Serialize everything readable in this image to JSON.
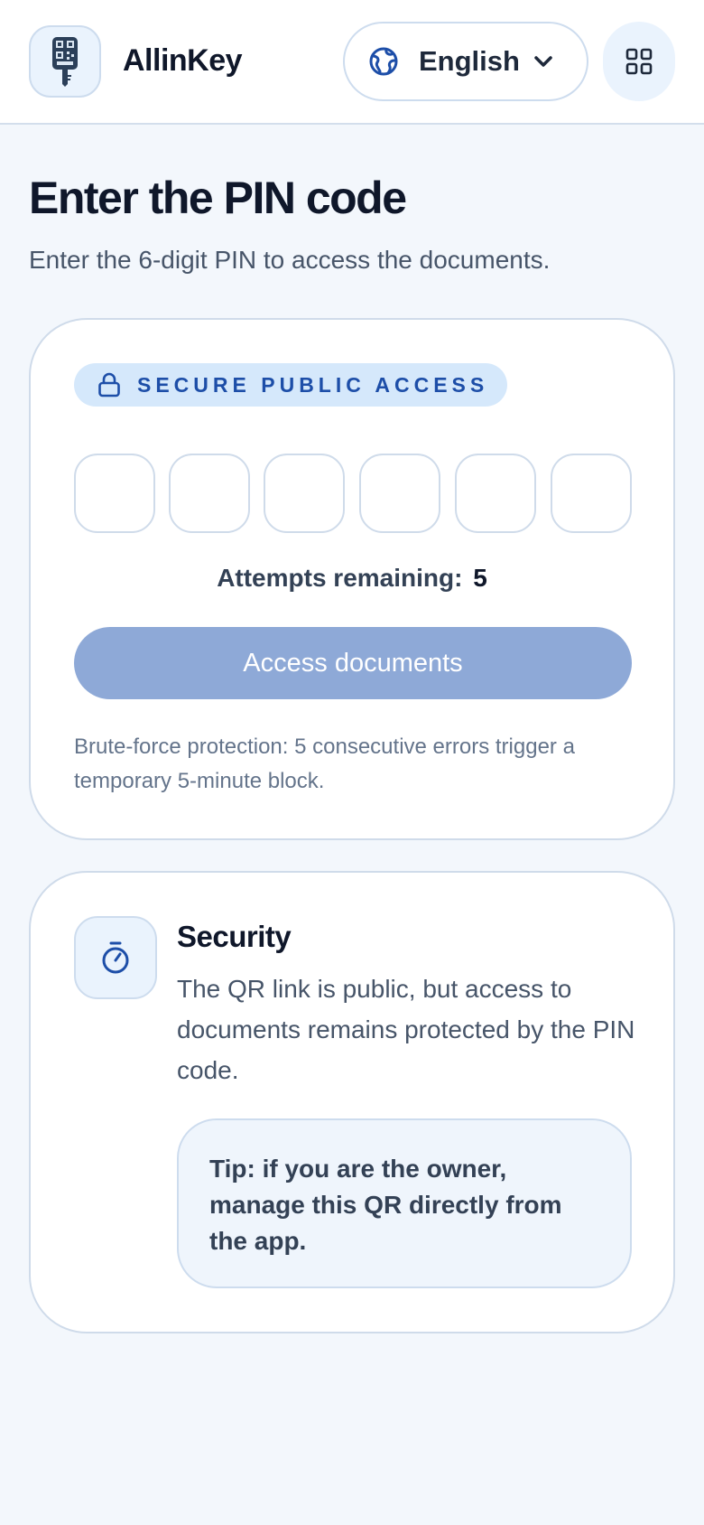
{
  "header": {
    "brand": "AllinKey",
    "language": {
      "selected": "English",
      "icon": "globe-icon",
      "chevron": "chevron-down-icon"
    },
    "menu_icon": "grid-icon",
    "logo_icon": "key-qr-icon"
  },
  "page": {
    "title": "Enter the PIN code",
    "subtitle": "Enter the 6-digit PIN to access the documents."
  },
  "pin_card": {
    "badge_icon": "lock-icon",
    "badge_label": "SECURE PUBLIC ACCESS",
    "digits": [
      "",
      "",
      "",
      "",
      "",
      ""
    ],
    "attempts_label": "Attempts remaining:",
    "attempts_value": "5",
    "button_label": "Access documents",
    "note": "Brute-force protection: 5 consecutive errors trigger a temporary 5-minute block."
  },
  "security_card": {
    "icon": "stopwatch-icon",
    "title": "Security",
    "description": "The QR link is public, but access to documents remains protected by the PIN code.",
    "tip": "Tip: if you are the owner, manage this QR directly from the app."
  },
  "colors": {
    "background": "#f3f7fc",
    "accent": "#1d4ea8",
    "button_disabled": "#8ea9d7",
    "badge_bg": "#d5e8fb",
    "border": "#cfdbea"
  }
}
